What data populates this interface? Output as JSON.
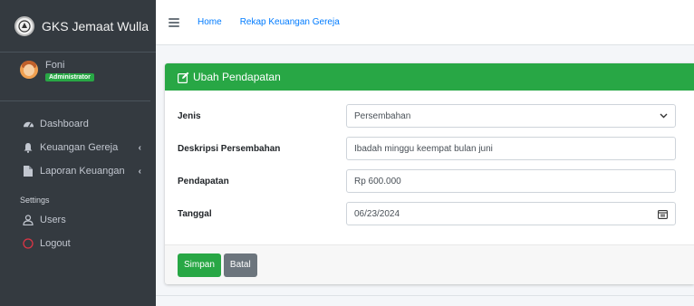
{
  "brand": {
    "name": "GKS Jemaat Wulla"
  },
  "user": {
    "name": "Foni",
    "role": "Administrator"
  },
  "sidebar": {
    "items": [
      {
        "label": "Dashboard",
        "icon": "tachometer-icon",
        "has_children": false
      },
      {
        "label": "Keuangan Gereja",
        "icon": "bell-icon",
        "has_children": true
      },
      {
        "label": "Laporan Keuangan",
        "icon": "file-icon",
        "has_children": true
      }
    ],
    "settings_header": "Settings",
    "settings_items": [
      {
        "label": "Users",
        "icon": "user-icon"
      },
      {
        "label": "Logout",
        "icon": "power-icon",
        "color": "#dc3545"
      }
    ],
    "chevron": "‹"
  },
  "topbar": {
    "links": [
      "Home",
      "Rekap Keuangan Gereja"
    ]
  },
  "card": {
    "title": "Ubah Pendapatan",
    "header_color": "#28a745",
    "fields": [
      {
        "label": "Jenis",
        "value": "Persembahan",
        "type": "select"
      },
      {
        "label": "Deskripsi Persembahan",
        "value": "Ibadah minggu keempat bulan juni",
        "type": "text"
      },
      {
        "label": "Pendapatan",
        "value": "Rp 600.000",
        "type": "text"
      },
      {
        "label": "Tanggal",
        "value": "06/23/2024",
        "type": "date"
      }
    ],
    "buttons": {
      "save": "Simpan",
      "cancel": "Batal"
    }
  },
  "colors": {
    "success": "#28a745",
    "secondary": "#6c757d",
    "link": "#007bff",
    "sidebar_bg": "#343a40"
  }
}
